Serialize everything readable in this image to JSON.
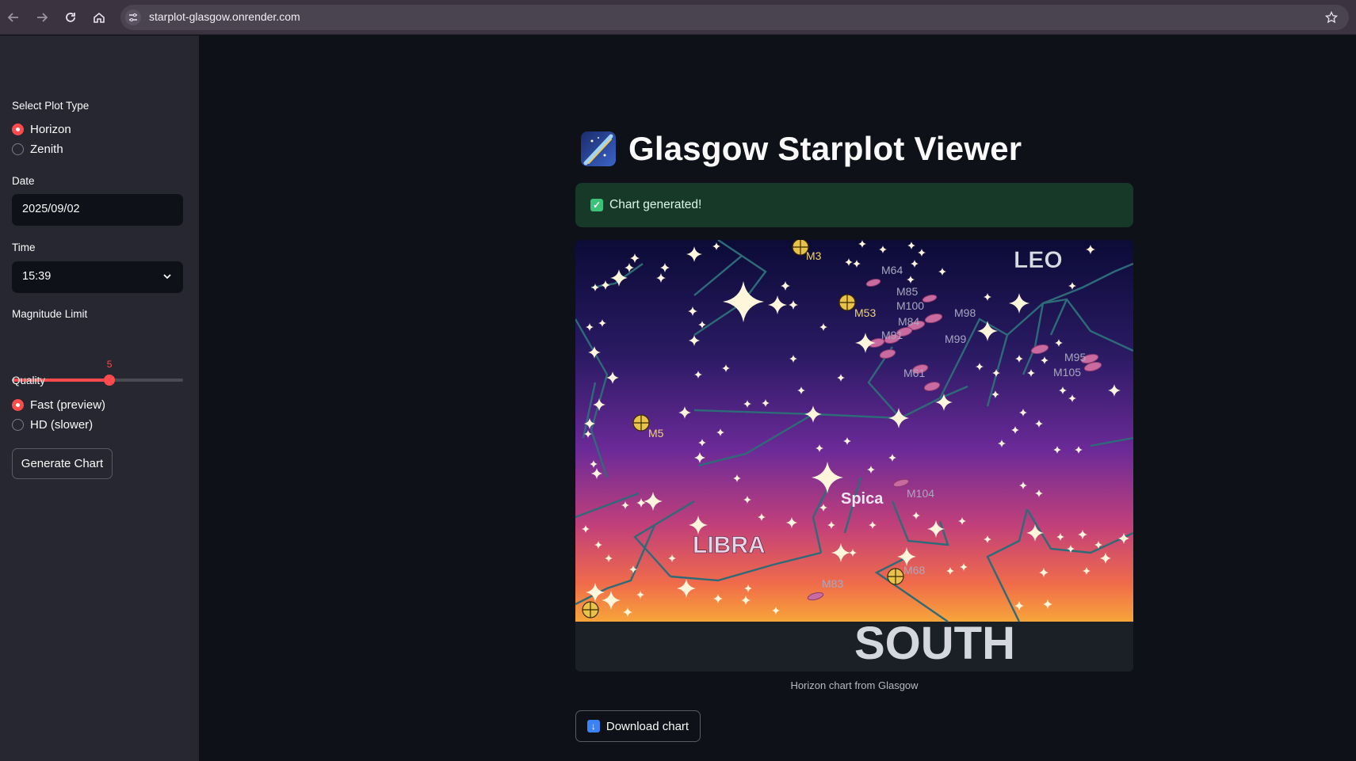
{
  "browser": {
    "url": "starplot-glasgow.onrender.com"
  },
  "sidebar": {
    "plot_type_label": "Select Plot Type",
    "plot_types": [
      "Horizon",
      "Zenith"
    ],
    "plot_type_selected": "Horizon",
    "date_label": "Date",
    "date_value": "2025/09/02",
    "time_label": "Time",
    "time_value": "15:39",
    "magnitude_label": "Magnitude Limit",
    "magnitude_value": "5",
    "magnitude_fraction": 0.57,
    "quality_label": "Quality",
    "quality_options": [
      "Fast (preview)",
      "HD (slower)"
    ],
    "quality_selected": "Fast (preview)",
    "generate_label": "Generate Chart"
  },
  "main": {
    "title": "Glasgow Starplot Viewer",
    "success_text": "Chart generated!",
    "caption": "Horizon chart from Glasgow",
    "download_label": "Download chart"
  },
  "chart": {
    "labels": {
      "constellations": [
        "LEO",
        "LIBRA"
      ],
      "stars": [
        "Spica"
      ],
      "direction": "SOUTH",
      "objects": [
        "M3",
        "M53",
        "M64",
        "M85",
        "M100",
        "M84",
        "M98",
        "M91",
        "M99",
        "M61",
        "M95",
        "M105",
        "M5",
        "M104",
        "M68",
        "M83"
      ]
    }
  },
  "icons": {
    "back": "back-arrow-icon",
    "forward": "forward-arrow-icon",
    "reload": "reload-icon",
    "home": "home-icon",
    "site_settings": "site-settings-icon",
    "bookmark": "star-bookmark-icon",
    "title": "shooting-star-icon",
    "success": "checkmark-icon",
    "download": "download-arrow-icon",
    "dropdown": "chevron-down-icon"
  },
  "colors": {
    "accent": "#ff4b4b",
    "success_bg": "#173928",
    "sidebar_bg": "#262730",
    "main_bg": "#0e1117"
  }
}
